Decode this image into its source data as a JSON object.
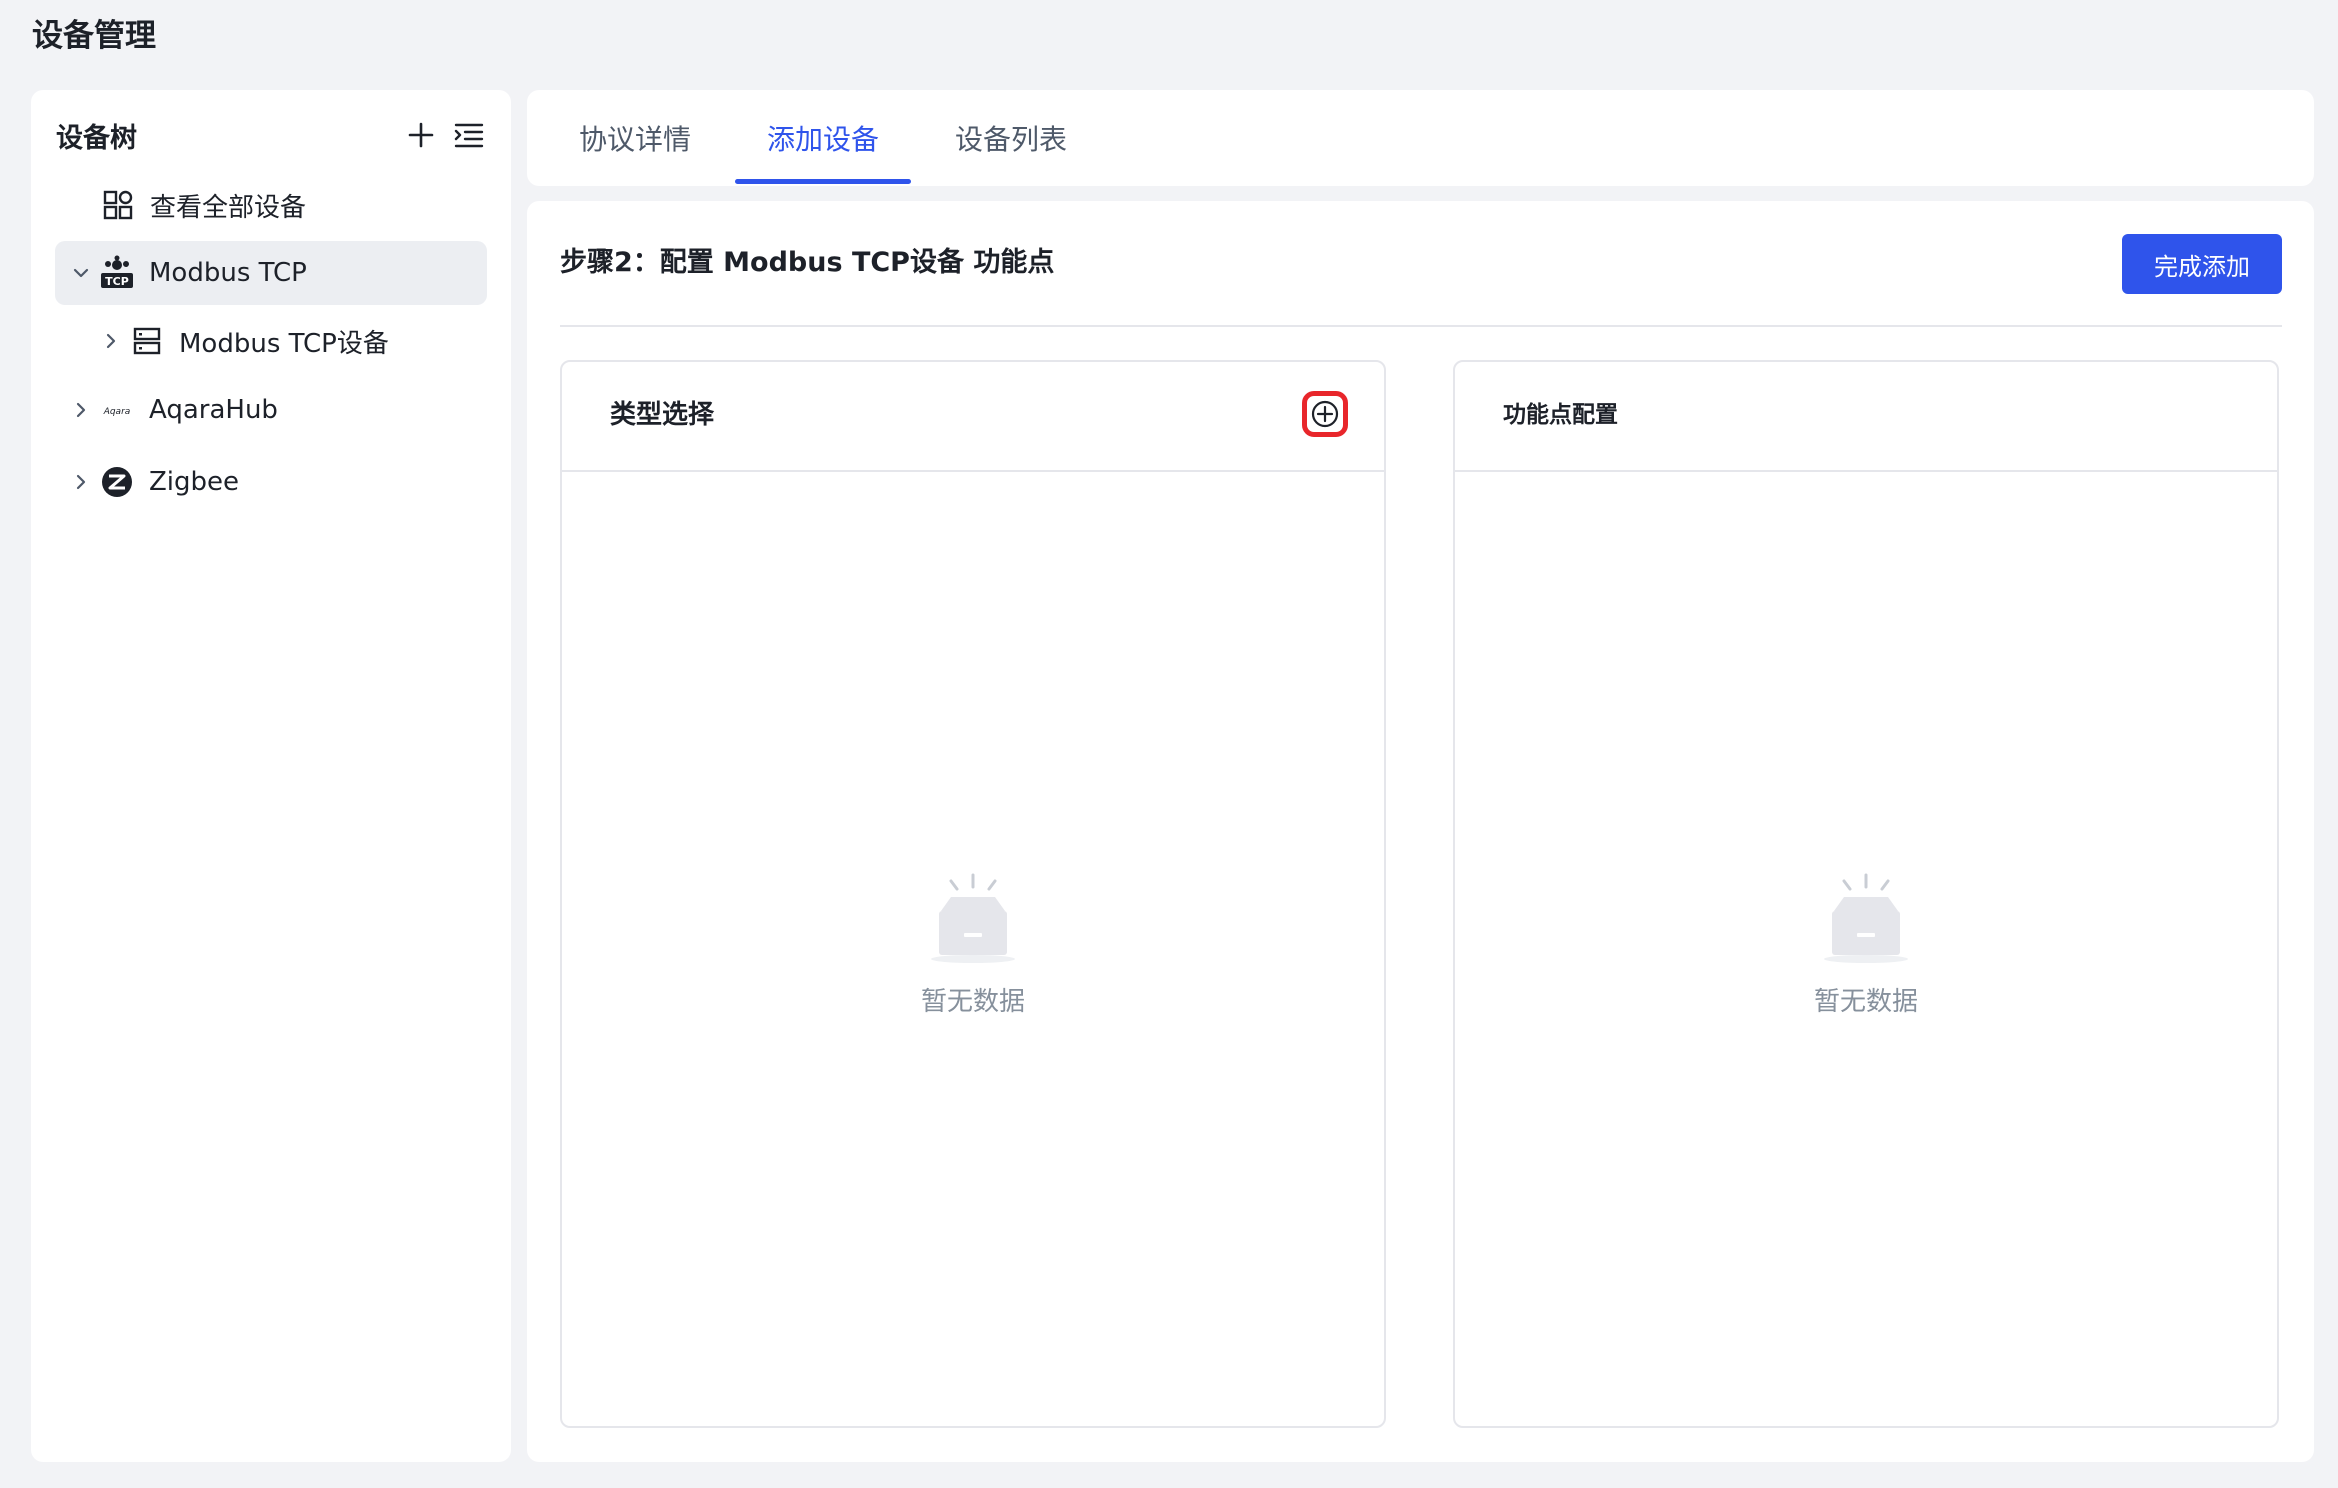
{
  "page": {
    "title": "设备管理"
  },
  "sidebar": {
    "title": "设备树",
    "items": [
      {
        "label": "查看全部设备"
      },
      {
        "label": "Modbus TCP",
        "badge": "TCP"
      },
      {
        "label": "Modbus TCP设备"
      },
      {
        "label": "AqaraHub",
        "logo_text": "Aqara"
      },
      {
        "label": "Zigbee"
      }
    ]
  },
  "tabs": [
    {
      "label": "协议详情"
    },
    {
      "label": "添加设备"
    },
    {
      "label": "设备列表"
    }
  ],
  "main": {
    "step_title": "步骤2：配置 Modbus TCP设备 功能点",
    "finish_label": "完成添加",
    "left_panel": {
      "title": "类型选择",
      "empty_text": "暂无数据"
    },
    "right_panel": {
      "title": "功能点配置",
      "empty_text": "暂无数据"
    }
  },
  "colors": {
    "accent": "#2f54eb",
    "highlight": "#e8262b",
    "background": "#f2f3f6"
  }
}
